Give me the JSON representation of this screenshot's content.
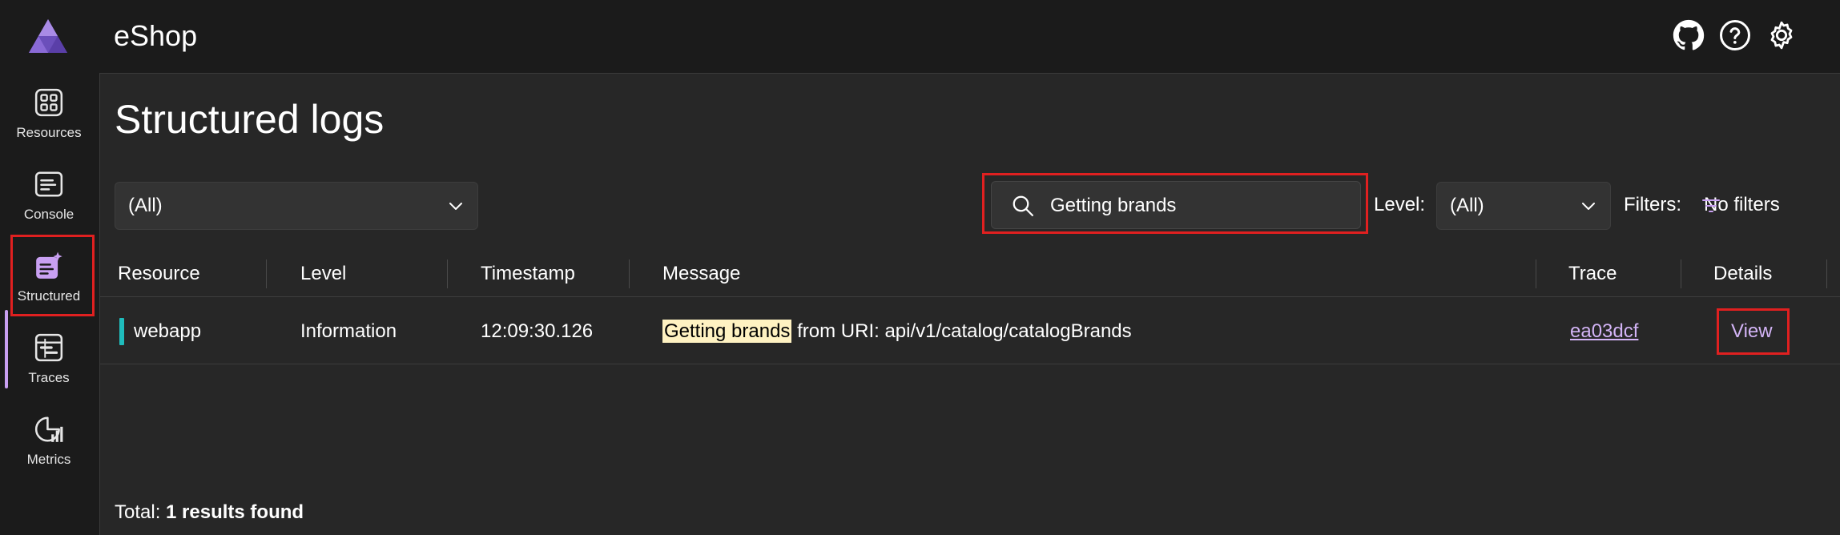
{
  "header": {
    "app_title": "eShop",
    "icons": [
      "github-icon",
      "help-icon",
      "settings-icon"
    ]
  },
  "nav": {
    "items": [
      {
        "label": "Resources",
        "icon": "resources-icon"
      },
      {
        "label": "Console",
        "icon": "console-icon"
      },
      {
        "label": "Structured",
        "icon": "structured-icon",
        "active": true
      },
      {
        "label": "Traces",
        "icon": "traces-icon"
      },
      {
        "label": "Metrics",
        "icon": "metrics-icon"
      }
    ]
  },
  "page": {
    "title": "Structured logs",
    "resource_filter": {
      "selected": "(All)"
    },
    "search": {
      "value": "Getting brands"
    },
    "level_label": "Level:",
    "level_filter": {
      "selected": "(All)"
    },
    "filters_label": "Filters:",
    "filters_value": "No filters"
  },
  "table": {
    "columns": [
      "Resource",
      "Level",
      "Timestamp",
      "Message",
      "Trace",
      "Details"
    ],
    "rows": [
      {
        "resource": "webapp",
        "level": "Information",
        "timestamp": "12:09:30.126",
        "message_highlight": "Getting brands",
        "message_rest": " from URI: api/v1/catalog/catalogBrands",
        "trace": "ea03dcf",
        "details": "View"
      }
    ]
  },
  "footer": {
    "total_label": "Total: ",
    "total_value": "1 results found"
  },
  "colors": {
    "accent": "#c9a0f2",
    "resource_webapp": "#1fbcbc",
    "highlight_bg": "#fff2c2",
    "link": "#d3b4f6",
    "annotation_box": "#e02020"
  }
}
